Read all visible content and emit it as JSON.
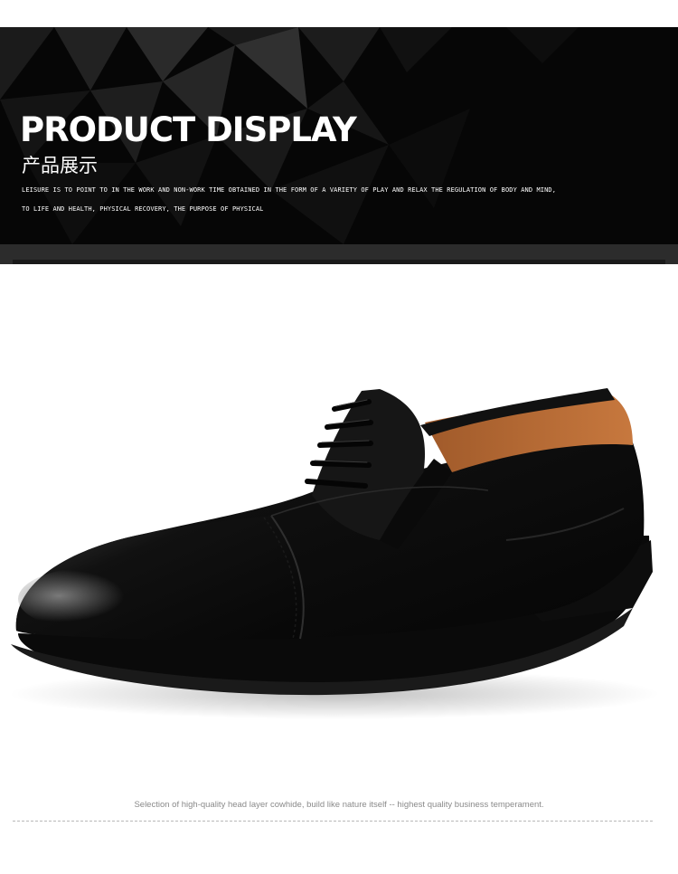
{
  "banner": {
    "title": "PRODUCT DISPLAY",
    "subtitle": "产品展示",
    "description": "LEISURE IS TO POINT TO IN THE WORK AND NON-WORK TIME OBTAINED IN THE FORM OF A VARIETY OF PLAY AND RELAX THE REGULATION OF BODY AND MIND, TO LIFE AND HEALTH, PHYSICAL RECOVERY, THE PURPOSE OF PHYSICAL"
  },
  "product": {
    "image_subject": "black-leather-cap-toe-oxford-shoe"
  },
  "caption": "Selection of high-quality head layer cowhide, build like nature itself -- highest quality business temperament.",
  "colors": {
    "banner_background": "#050505",
    "banner_text": "#ffffff",
    "caption_text": "#8a8a8a",
    "page_background": "#ffffff"
  }
}
